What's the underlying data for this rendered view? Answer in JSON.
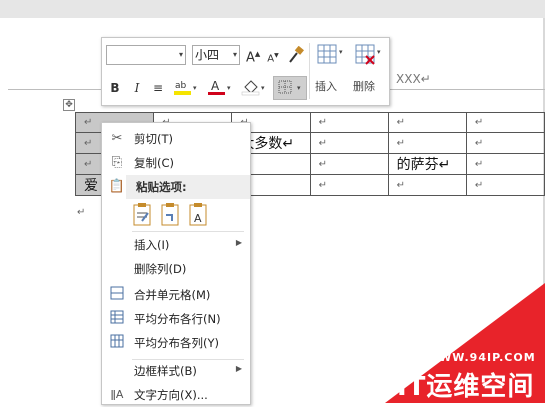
{
  "document": {
    "heading_text": "XXX↵",
    "paragraph_mark": "↵",
    "move_handle": "✥",
    "table": [
      [
        "↵",
        "↵",
        "↵",
        "↵",
        "↵",
        "↵"
      ],
      [
        "↵",
        "↵",
        "大多数↵",
        "↵",
        "↵",
        "↵"
      ],
      [
        "↵",
        "↵",
        "↵",
        "↵",
        "的萨芬↵",
        "↵"
      ],
      [
        "爱",
        "↵",
        "↵",
        "↵",
        "↵",
        "↵"
      ]
    ]
  },
  "mini_toolbar": {
    "font_name": "",
    "font_size": "小四",
    "grow_font": "A",
    "shrink_font": "A",
    "bold": "B",
    "italic": "I",
    "center": "≡",
    "insert_label": "插入",
    "delete_label": "删除",
    "colors": {
      "highlight": "#f5e400",
      "font_color": "#d0021b",
      "shading": "#ffffff",
      "border_hover": "#cfcfcf"
    }
  },
  "context_menu": {
    "items": [
      {
        "label": "剪切(T)",
        "icon": "scissors-icon"
      },
      {
        "label": "复制(C)",
        "icon": "copy-icon"
      },
      {
        "label": "粘贴选项:",
        "icon": "paste-icon"
      },
      {
        "label": "插入(I)",
        "icon": ""
      },
      {
        "label": "删除列(D)",
        "icon": ""
      },
      {
        "label": "合并单元格(M)",
        "icon": "merge-cells-icon"
      },
      {
        "label": "平均分布各行(N)",
        "icon": "distribute-rows-icon"
      },
      {
        "label": "平均分布各列(Y)",
        "icon": "distribute-columns-icon"
      },
      {
        "label": "边框样式(B)",
        "icon": ""
      },
      {
        "label": "文字方向(X)...",
        "icon": "text-direction-icon"
      }
    ]
  },
  "watermark": {
    "url": "WWW.94IP.COM",
    "name": "IT运维空间",
    "color": "#e8232a"
  }
}
